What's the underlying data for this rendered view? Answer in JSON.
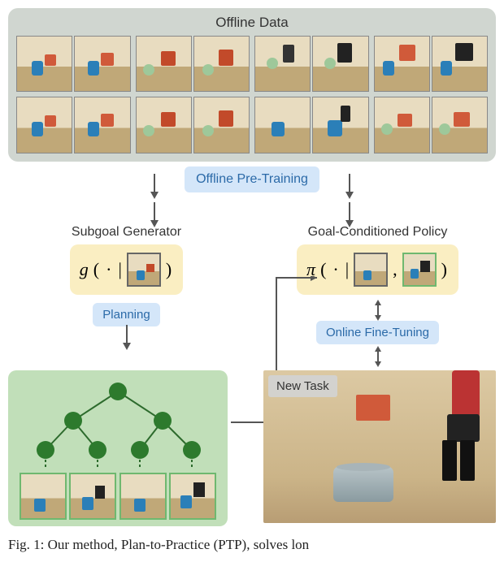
{
  "offline_title": "Offline Data",
  "pretrain_label": "Offline Pre-Training",
  "subgoal_title": "Subgoal Generator",
  "policy_title": "Goal-Conditioned Policy",
  "g_symbol": "g",
  "pi_symbol": "π",
  "func_open": "(",
  "func_dot": " · ",
  "func_bar": "|",
  "func_comma": ",",
  "func_close": ")",
  "planning_label": "Planning",
  "finetune_label": "Online Fine-Tuning",
  "newtask_label": "New Task",
  "caption_prefix": "Fig. 1: Our method, Plan-to-Practice (PTP), solves lon"
}
